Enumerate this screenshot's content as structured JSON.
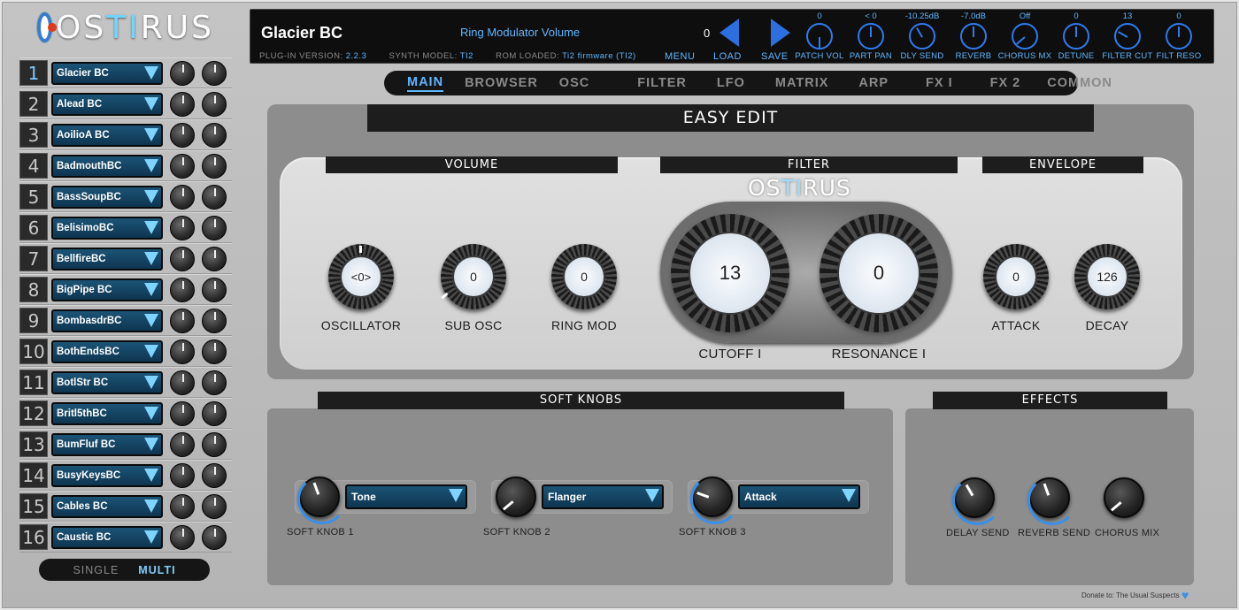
{
  "logo": {
    "pre": "OS",
    "mid": "TI",
    "post": "RUS"
  },
  "parts": [
    {
      "num": "1",
      "name": "Glacier BC"
    },
    {
      "num": "2",
      "name": "Alead BC"
    },
    {
      "num": "3",
      "name": "AoilioA BC"
    },
    {
      "num": "4",
      "name": "BadmouthBC"
    },
    {
      "num": "5",
      "name": "BassSoupBC"
    },
    {
      "num": "6",
      "name": "BelisimoBC"
    },
    {
      "num": "7",
      "name": "BellfireBC"
    },
    {
      "num": "8",
      "name": "BigPipe BC"
    },
    {
      "num": "9",
      "name": "BombasdrBC"
    },
    {
      "num": "10",
      "name": "BothEndsBC"
    },
    {
      "num": "11",
      "name": "BotlStr BC"
    },
    {
      "num": "12",
      "name": "Britl5thBC"
    },
    {
      "num": "13",
      "name": "BumFluf BC"
    },
    {
      "num": "14",
      "name": "BusyKeysBC"
    },
    {
      "num": "15",
      "name": "Cables BC"
    },
    {
      "num": "16",
      "name": "Caustic BC"
    }
  ],
  "mode": {
    "single": "SINGLE",
    "multi": "MULTI"
  },
  "display": {
    "patch_name": "Glacier BC",
    "param_name": "Ring Modulator Volume",
    "param_value": "0",
    "plugin_version_label": "PLUG-IN VERSION:",
    "plugin_version": "2.2.3",
    "synth_model_label": "SYNTH MODEL:",
    "synth_model": "TI2",
    "rom_label": "ROM LOADED:",
    "rom": "Ti2 firmware (TI2)",
    "menu": "MENU",
    "load": "LOAD",
    "save": "SAVE"
  },
  "top_knobs": [
    {
      "label": "PATCH VOL",
      "value": "0"
    },
    {
      "label": "PART PAN",
      "value": "< 0"
    },
    {
      "label": "DLY SEND",
      "value": "-10.25dB"
    },
    {
      "label": "REVERB",
      "value": "-7.0dB"
    },
    {
      "label": "CHORUS MX",
      "value": "Off"
    },
    {
      "label": "DETUNE",
      "value": "0"
    },
    {
      "label": "FILTER CUT",
      "value": "13"
    },
    {
      "label": "FILT RESO",
      "value": "0"
    }
  ],
  "tabs": [
    "MAIN",
    "BROWSER",
    "OSC",
    "FILTER",
    "LFO",
    "MATRIX",
    "ARP",
    "FX I",
    "FX 2",
    "COMMON"
  ],
  "easy_edit": {
    "title": "EASY EDIT",
    "volume_title": "VOLUME",
    "filter_title": "FILTER",
    "envelope_title": "ENVELOPE",
    "knobs": {
      "oscillator": {
        "label": "OSCILLATOR",
        "value": "<0>"
      },
      "sub_osc": {
        "label": "SUB OSC",
        "value": "0"
      },
      "ring_mod": {
        "label": "RING MOD",
        "value": "0"
      },
      "cutoff": {
        "label": "CUTOFF I",
        "value": "13"
      },
      "resonance": {
        "label": "RESONANCE I",
        "value": "0"
      },
      "attack": {
        "label": "ATTACK",
        "value": "0"
      },
      "decay": {
        "label": "DECAY",
        "value": "126"
      }
    }
  },
  "soft_knobs": {
    "title": "SOFT KNOBS",
    "items": [
      {
        "label": "SOFT KNOB 1",
        "target": "Tone"
      },
      {
        "label": "SOFT KNOB 2",
        "target": "Flanger"
      },
      {
        "label": "SOFT KNOB 3",
        "target": "Attack"
      }
    ]
  },
  "effects": {
    "title": "EFFECTS",
    "items": [
      {
        "label": "DELAY SEND"
      },
      {
        "label": "REVERB SEND"
      },
      {
        "label": "CHORUS MIX"
      }
    ]
  },
  "footer": {
    "donate": "Donate to: The Usual Suspects"
  },
  "colors": {
    "accent": "#5fb6ff",
    "selector": "#1c5476",
    "panel": "#8d8d8d"
  }
}
